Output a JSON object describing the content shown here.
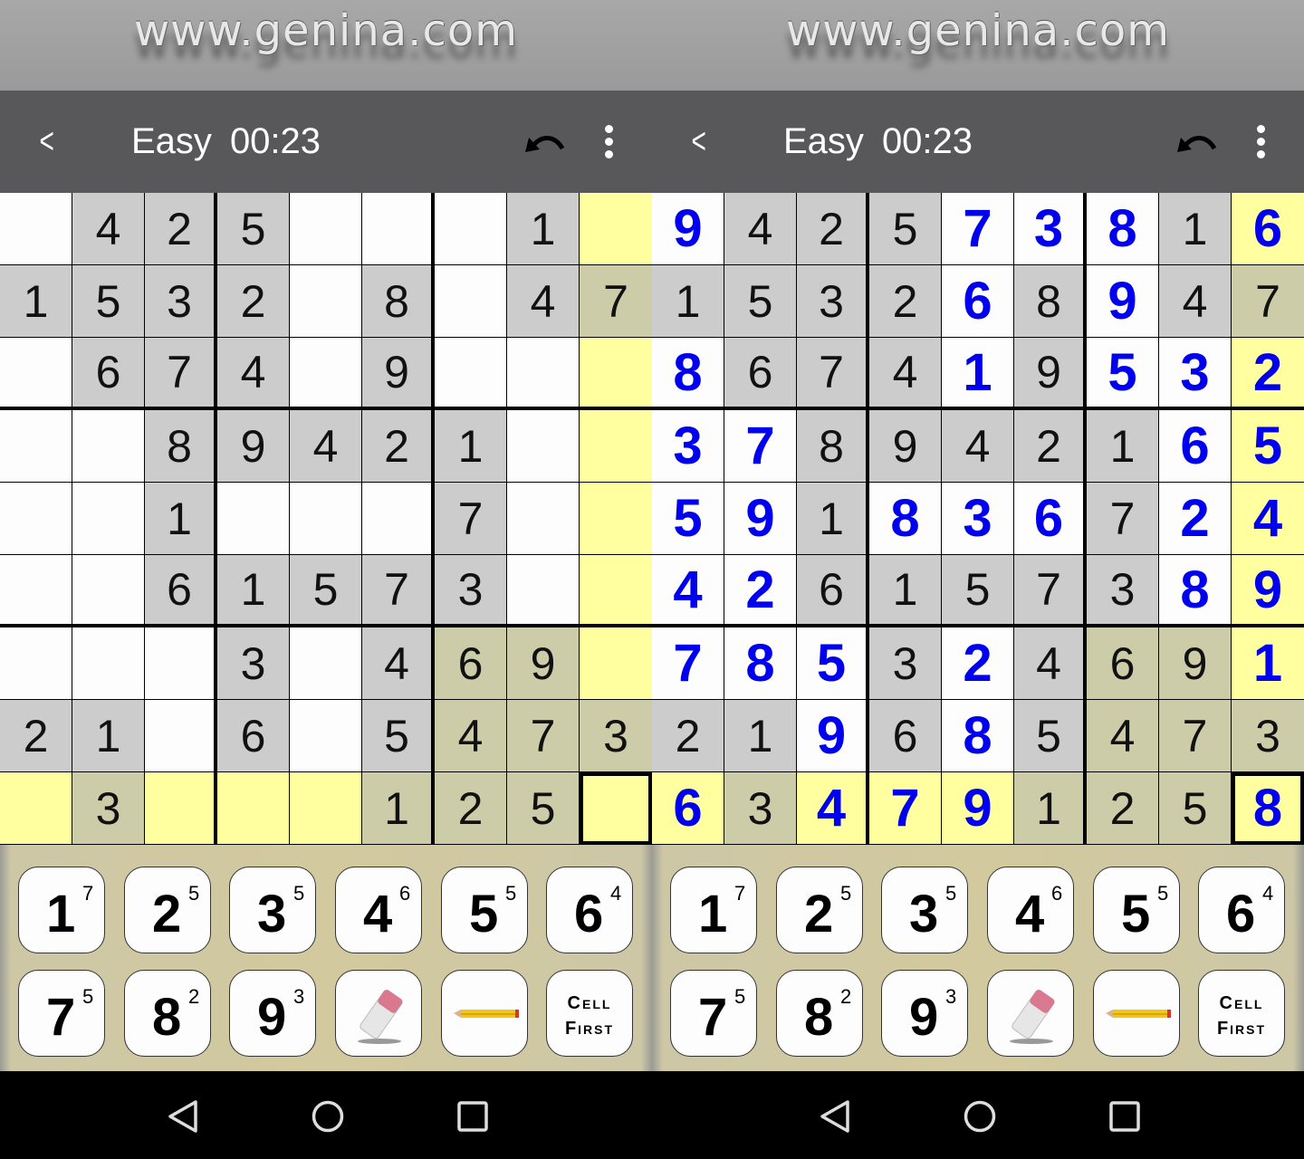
{
  "banner": {
    "text": "www.genina.com"
  },
  "header": {
    "difficulty": "Easy",
    "timer": "00:23"
  },
  "colors": {
    "white": "#fdfdfd",
    "gray": "#cccccc",
    "olive": "#cdcca8",
    "yellow": "#ffffa0",
    "entered": "#0000ee",
    "header": "#58585a"
  },
  "panels": [
    {
      "rows": [
        [
          "",
          "4",
          "2",
          "5",
          "",
          "",
          "",
          "1",
          ""
        ],
        [
          "1",
          "5",
          "3",
          "2",
          "",
          "8",
          "",
          "4",
          "7"
        ],
        [
          "",
          "6",
          "7",
          "4",
          "",
          "9",
          "",
          "",
          ""
        ],
        [
          "",
          "",
          "8",
          "9",
          "4",
          "2",
          "1",
          "",
          ""
        ],
        [
          "",
          "",
          "1",
          "",
          "",
          "",
          "7",
          "",
          ""
        ],
        [
          "",
          "",
          "6",
          "1",
          "5",
          "7",
          "3",
          "",
          ""
        ],
        [
          "",
          "",
          "",
          "3",
          "",
          "4",
          "6",
          "9",
          ""
        ],
        [
          "2",
          "1",
          "",
          "6",
          "",
          "5",
          "4",
          "7",
          "3"
        ],
        [
          "",
          "3",
          "",
          "",
          "",
          "1",
          "2",
          "5",
          ""
        ]
      ],
      "entered": [
        "000000000",
        "000000000",
        "000000000",
        "000000000",
        "000000000",
        "000000000",
        "000000000",
        "000000000",
        "000000000"
      ]
    },
    {
      "rows": [
        [
          "9",
          "4",
          "2",
          "5",
          "7",
          "3",
          "8",
          "1",
          "6"
        ],
        [
          "1",
          "5",
          "3",
          "2",
          "6",
          "8",
          "9",
          "4",
          "7"
        ],
        [
          "8",
          "6",
          "7",
          "4",
          "1",
          "9",
          "5",
          "3",
          "2"
        ],
        [
          "3",
          "7",
          "8",
          "9",
          "4",
          "2",
          "1",
          "6",
          "5"
        ],
        [
          "5",
          "9",
          "1",
          "8",
          "3",
          "6",
          "7",
          "2",
          "4"
        ],
        [
          "4",
          "2",
          "6",
          "1",
          "5",
          "7",
          "3",
          "8",
          "9"
        ],
        [
          "7",
          "8",
          "5",
          "3",
          "2",
          "4",
          "6",
          "9",
          "1"
        ],
        [
          "2",
          "1",
          "9",
          "6",
          "8",
          "5",
          "4",
          "7",
          "3"
        ],
        [
          "6",
          "3",
          "4",
          "7",
          "9",
          "1",
          "2",
          "5",
          "8"
        ]
      ],
      "entered": [
        "100011101",
        "000010100",
        "100010111",
        "110000011",
        "110111011",
        "110000011",
        "111010001",
        "001010000",
        "101110001"
      ]
    }
  ],
  "cell_backgrounds": [
    "wgggwwwgy",
    "ggggwgwgo",
    "wgggwgwwy",
    "wwgggggwy",
    "wwgwwwgwy",
    "wwgggggwy",
    "wwwgwgooy",
    "ggwgwgooo",
    "yoyyyoooy"
  ],
  "selected_cell": {
    "row": 9,
    "col": 9
  },
  "keypad": {
    "digits": [
      {
        "digit": "1",
        "count": "7"
      },
      {
        "digit": "2",
        "count": "5"
      },
      {
        "digit": "3",
        "count": "5"
      },
      {
        "digit": "4",
        "count": "6"
      },
      {
        "digit": "5",
        "count": "5"
      },
      {
        "digit": "6",
        "count": "4"
      },
      {
        "digit": "7",
        "count": "5"
      },
      {
        "digit": "8",
        "count": "2"
      },
      {
        "digit": "9",
        "count": "3"
      }
    ],
    "cell_first_line1": "Cell",
    "cell_first_line2": "First"
  }
}
